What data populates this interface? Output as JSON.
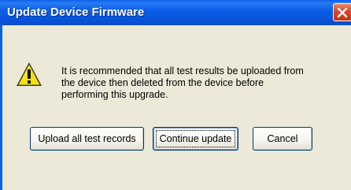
{
  "window": {
    "title": "Update Device Firmware",
    "close_icon": "close-icon"
  },
  "dialog": {
    "icon": "warning-icon",
    "message_lines": [
      "It is recommended that all test results be uploaded from",
      "the device then deleted from the device before",
      "performing this upgrade."
    ]
  },
  "buttons": {
    "upload_label": "Upload all test records",
    "continue_label": "Continue update",
    "cancel_label": "Cancel"
  },
  "colors": {
    "titlebar": "#0a5fe8",
    "dialog_bg": "#ece9d8",
    "close_button": "#d8432a"
  }
}
